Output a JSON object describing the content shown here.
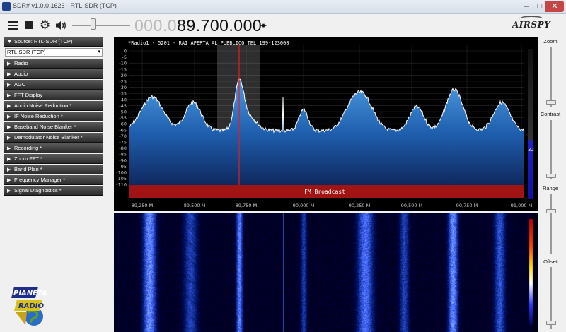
{
  "window": {
    "title": "SDR# v1.0.0.1626 - RTL-SDR (TCP)",
    "min": "–",
    "max": "□",
    "close": "✕"
  },
  "toolbar": {
    "freq_dim": "000.0",
    "freq_bright": "89.700.000",
    "tune_arrows": "◂▸",
    "volume_level": 0.34,
    "brand_logo_text": "AIRSPY"
  },
  "panel": {
    "source_header": "Source: RTL-SDR (TCP)",
    "source_value": "RTL-SDR (TCP)",
    "items": [
      "Radio",
      "Audio",
      "AGC",
      "FFT Display",
      "Audio Noise Reduction *",
      "IF Noise Reduction *",
      "Baseband Noise Blanker *",
      "Demodulator Noise Blanker *",
      "Recording *",
      "Zoom FFT *",
      "Band Plan *",
      "Frequency Manager *",
      "Signal Diagnostics *"
    ]
  },
  "logo_text": [
    "PIANETA",
    "RADIO"
  ],
  "spectrum": {
    "rds_text": "*Radio1  - 5201 - RAI APERTA AL PUBBLICO TEL 199-123000",
    "band_label": "FM Broadcast",
    "y_ticks": [
      "0",
      "-5",
      "-10",
      "-15",
      "-20",
      "-25",
      "-30",
      "-35",
      "-40",
      "-45",
      "-50",
      "-55",
      "-60",
      "-65",
      "-70",
      "-75",
      "-80",
      "-85",
      "-90",
      "-95",
      "-100",
      "-105",
      "-110"
    ],
    "x_ticks": [
      "89,250 M",
      "89,500 M",
      "89,750 M",
      "90,000 M",
      "90,250 M",
      "90,500 M",
      "90,750 M",
      "91,000 M"
    ],
    "snr_value": "32",
    "trace_color": "#ffffff",
    "fill_color": "#1e64b4"
  },
  "right_controls": {
    "zoom_label": "Zoom",
    "contrast_label": "Contrast",
    "range_label": "Range",
    "offset_label": "Offset"
  }
}
